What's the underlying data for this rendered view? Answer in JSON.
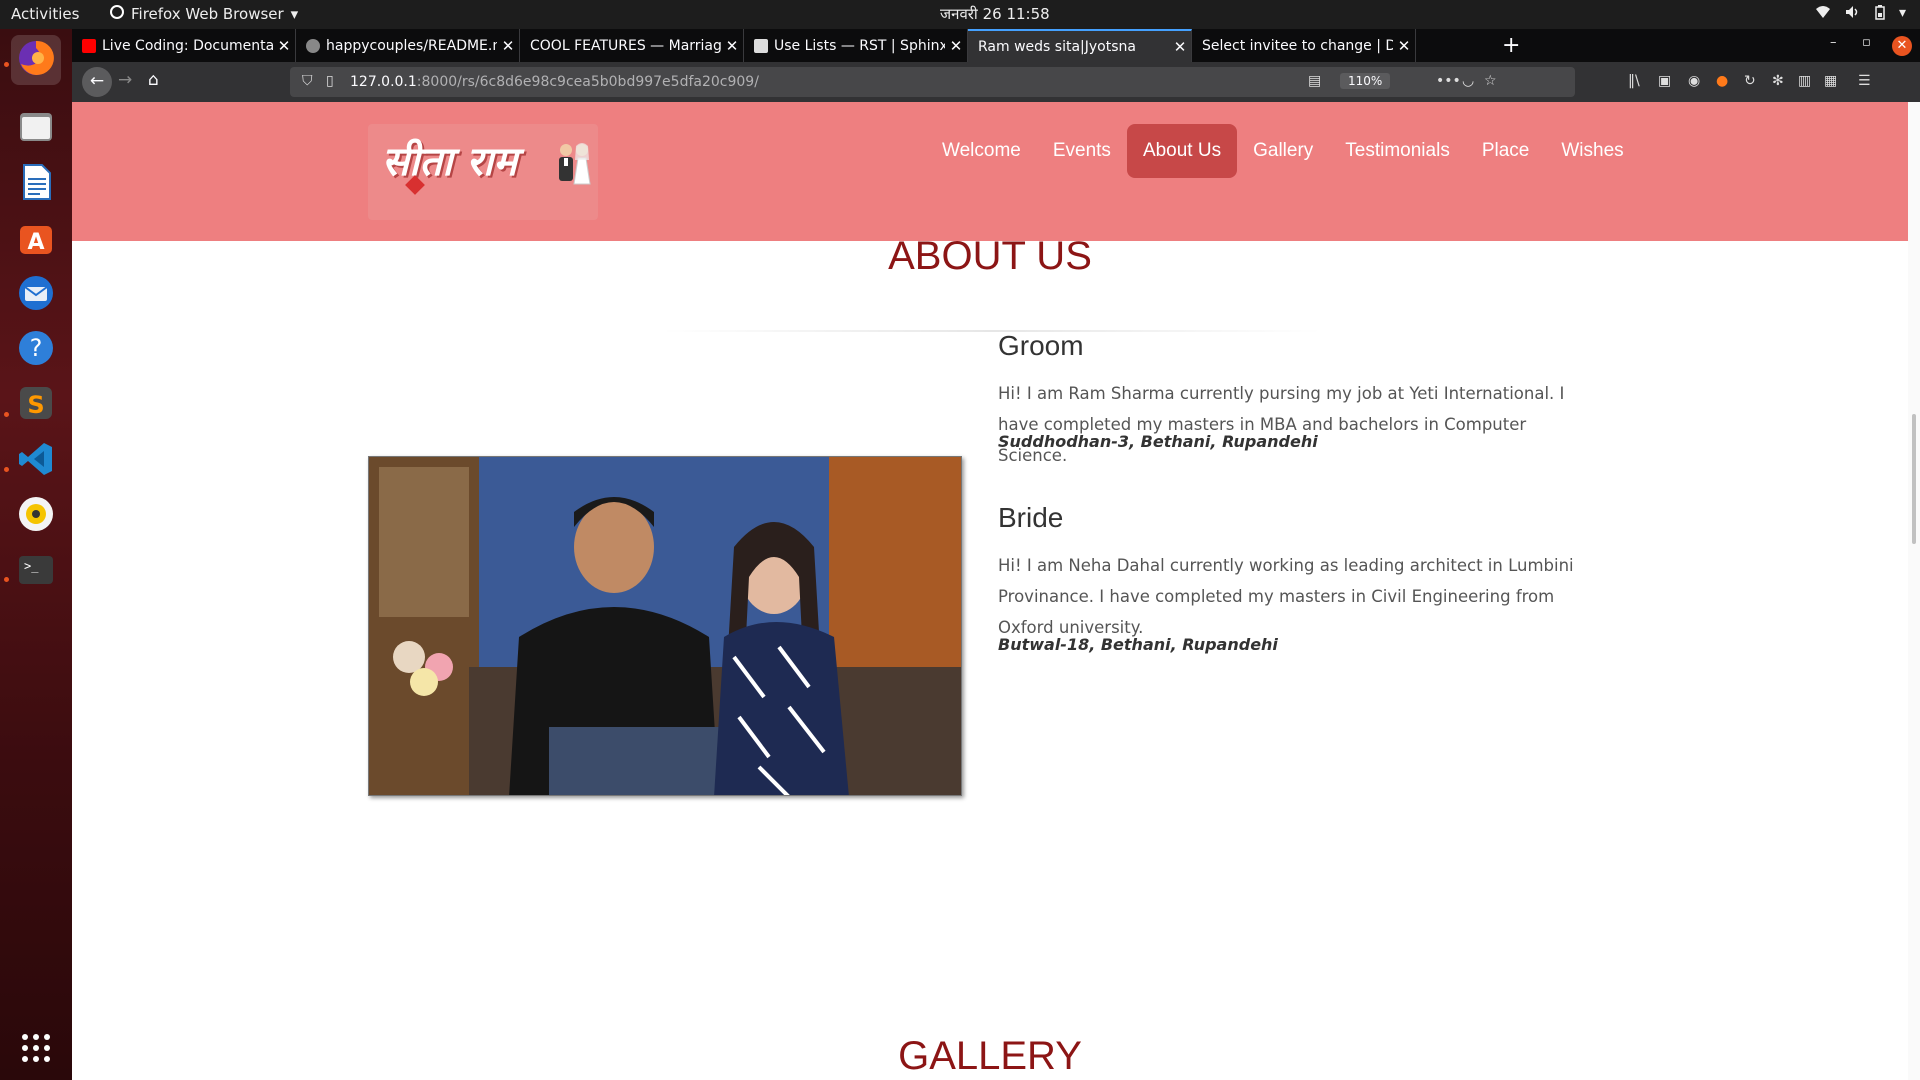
{
  "topbar": {
    "activities": "Activities",
    "app_name": "Firefox Web Browser",
    "clock": "जनवरी 26  11:58"
  },
  "tabs": [
    {
      "title": "Live Coding: Documentati",
      "favicon_color": "#ff0000"
    },
    {
      "title": "happycouples/README.md",
      "favicon_color": "#888888"
    },
    {
      "title": "COOL FEATURES — Marriag",
      "favicon_color": ""
    },
    {
      "title": "Use Lists — RST | Sphinx",
      "favicon_color": "#dddddd"
    },
    {
      "title": "Ram weds sita|Jyotsna",
      "favicon_color": ""
    },
    {
      "title": "Select invitee to change | Dj",
      "favicon_color": ""
    }
  ],
  "urlbar": {
    "host": "127.0.0.1",
    "path": ":8000/rs/6c8d6e98c9cea5b0bd997e5dfa20c909/",
    "zoom": "110%"
  },
  "site": {
    "logo_text": "सीता राम",
    "nav": [
      "Welcome",
      "Events",
      "About Us",
      "Gallery",
      "Testimonials",
      "Place",
      "Wishes"
    ],
    "active_nav": "About Us",
    "about_title": "ABOUT US",
    "groom": {
      "heading": "Groom",
      "text": "Hi! I am Ram Sharma currently pursing my job at Yeti International. I have completed my masters in MBA and bachelors in Computer Science.",
      "address": "Suddhodhan-3, Bethani, Rupandehi"
    },
    "bride": {
      "heading": "Bride",
      "text": "Hi! I am Neha Dahal currently working as leading architect in Lumbini Provinance. I have completed my masters in Civil Engineering from Oxford university.",
      "address": "Butwal-18, Bethani, Rupandehi"
    },
    "gallery_title": "GALLERY"
  },
  "colors": {
    "header_bg": "#ee7f80",
    "nav_active_bg": "#c74848",
    "title_color": "#8c1515"
  }
}
